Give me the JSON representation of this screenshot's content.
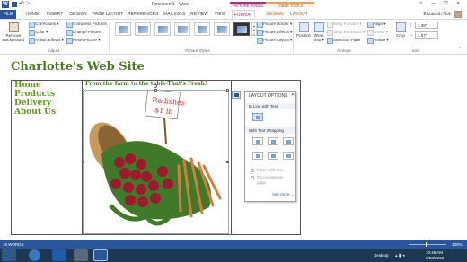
{
  "colors": {
    "word_blue": "#2b579a",
    "format_pink": "#a33380",
    "heading_green": "#4a7a22",
    "body_green": "#5b9a1f",
    "taskbar": "#1c3853"
  },
  "window": {
    "title": "Document1 - Word",
    "help": "?",
    "minimize": "—",
    "restore": "❐",
    "close": "✕"
  },
  "contextual": {
    "picture_tools": "PICTURE TOOLS",
    "table_tools": "TABLE TOOLS"
  },
  "tabs": [
    "FILE",
    "HOME",
    "INSERT",
    "DESIGN",
    "PAGE LAYOUT",
    "REFERENCES",
    "MAILINGS",
    "REVIEW",
    "VIEW",
    "FORMAT",
    "DESIGN",
    "LAYOUT"
  ],
  "user": "Elizabeth Noh",
  "ribbon": {
    "remove_bg_1": "Remove",
    "remove_bg_2": "Background",
    "corrections": "Corrections ▾",
    "color": "Color ▾",
    "artistic": "Artistic Effects ▾",
    "compress": "Compress Pictures",
    "change": "Change Picture",
    "reset": "Reset Picture ▾",
    "adjust": "Adjust",
    "picture_styles": "Picture Styles",
    "border": "Picture Border ▾",
    "effects": "Picture Effects ▾",
    "layout": "Picture Layout ▾",
    "position": "Position",
    "wrap_1": "Wrap",
    "wrap_2": "Text ▾",
    "bring_forward": "Bring Forward ▾",
    "send_backward": "Send Backward ▾",
    "selection_pane": "Selection Pane",
    "align": "Align ▾",
    "group": "Group ▾",
    "rotate": "Rotate ▾",
    "arrange": "Arrange",
    "crop": "Crop",
    "height": "4.38\"",
    "width": "4.57\"",
    "size": "Size"
  },
  "document": {
    "heading": "Charlotte's Web Site",
    "nav": [
      "Home",
      "Products",
      "Delivery",
      "About Us"
    ],
    "tagline": "From the farm to the table-That's Fresh!",
    "sign_1": "Radishes",
    "sign_2": "$1 lb"
  },
  "layout_options": {
    "title": "LAYOUT OPTIONS",
    "close": "✕",
    "in_line": "In Line with Text",
    "with_wrap": "With Text Wrapping",
    "move_with_text": "Move with text",
    "fix_position_1": "Fix position on",
    "fix_position_2": "page",
    "see_more": "See more..."
  },
  "status": {
    "words": "15 WORDS",
    "zoom": "100%"
  },
  "taskbar": {
    "desktop": "Desktop",
    "time": "10:46 AM",
    "date": "5/23/2013"
  }
}
